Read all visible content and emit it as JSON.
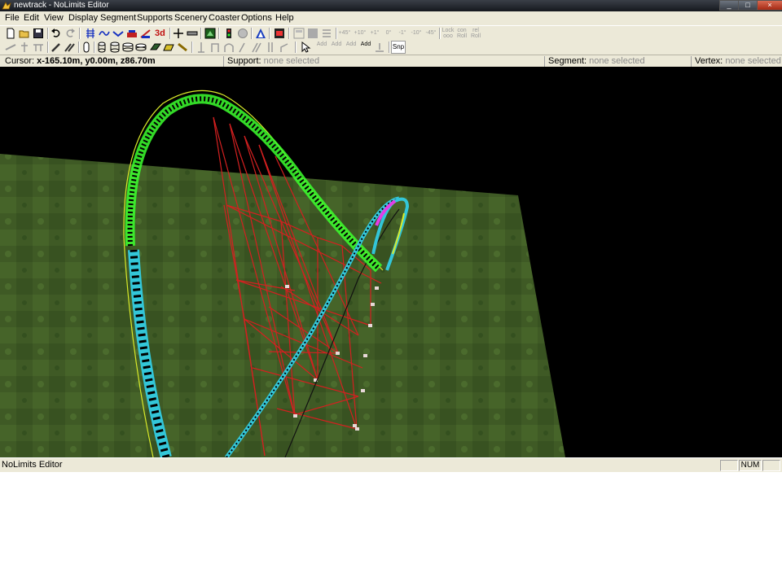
{
  "window": {
    "title": "newtrack - NoLimits Editor",
    "minimize": "_",
    "maximize": "□",
    "close": "×"
  },
  "menu": [
    "File",
    "Edit",
    "View",
    "Display",
    "Segment",
    "Supports",
    "Scenery",
    "Coaster",
    "Options",
    "Help"
  ],
  "toolbar": {
    "three_d_label": "3d",
    "roll_buttons": [
      "+45°",
      "+10°",
      "+1°",
      "0°",
      "-1°",
      "-10°",
      "-45°"
    ],
    "lock_roll": "Lock\nooo",
    "con_roll": "con\nRoll",
    "rel_roll": "rel\nRoll",
    "add_buttons": [
      "Add",
      "Add",
      "Add",
      "Add"
    ],
    "snap_label": "Snp"
  },
  "info": {
    "cursor_label": "Cursor:",
    "cursor_value": "x-165.10m, y0.00m, z86.70m",
    "support_label": "Support:",
    "support_value": "none selected",
    "segment_label": "Segment:",
    "segment_value": "none selected",
    "vertex_label": "Vertex:",
    "vertex_value": "none selected"
  },
  "status": {
    "text": "NoLimits Editor",
    "num": "NUM"
  },
  "colors": {
    "ground": "#3f5a25",
    "track_loop": "#3cff2e",
    "track_blue": "#33c6d8",
    "support": "#d42020",
    "magenta": "#e23ee6"
  }
}
